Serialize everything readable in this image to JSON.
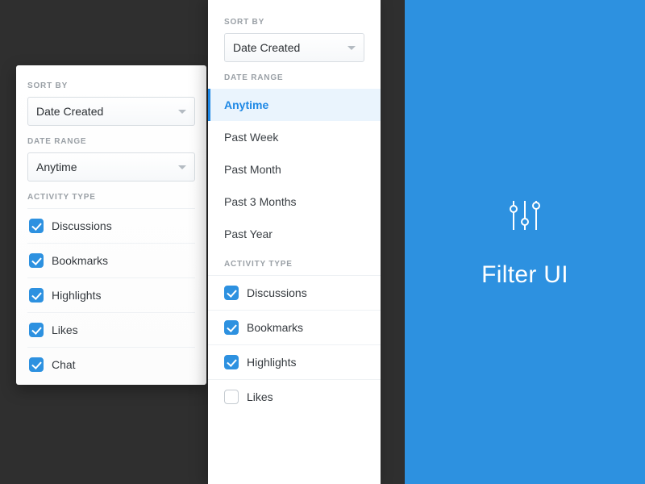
{
  "banner": {
    "title": "Filter UI"
  },
  "labels": {
    "sortBy": "SORT BY",
    "dateRange": "DATE RANGE",
    "activityType": "ACTIVITY TYPE"
  },
  "back": {
    "sortBy": "Date Created",
    "dateRange": "Anytime",
    "activities": [
      {
        "label": "Discussions",
        "checked": true
      },
      {
        "label": "Bookmarks",
        "checked": true
      },
      {
        "label": "Highlights",
        "checked": true
      },
      {
        "label": "Likes",
        "checked": true
      },
      {
        "label": "Chat",
        "checked": true
      }
    ]
  },
  "front": {
    "sortBy": "Date Created",
    "dateRanges": [
      {
        "label": "Anytime",
        "selected": true
      },
      {
        "label": "Past Week",
        "selected": false
      },
      {
        "label": "Past Month",
        "selected": false
      },
      {
        "label": "Past 3 Months",
        "selected": false
      },
      {
        "label": "Past Year",
        "selected": false
      }
    ],
    "activities": [
      {
        "label": "Discussions",
        "checked": true
      },
      {
        "label": "Bookmarks",
        "checked": true
      },
      {
        "label": "Highlights",
        "checked": true
      },
      {
        "label": "Likes",
        "checked": false
      }
    ]
  }
}
